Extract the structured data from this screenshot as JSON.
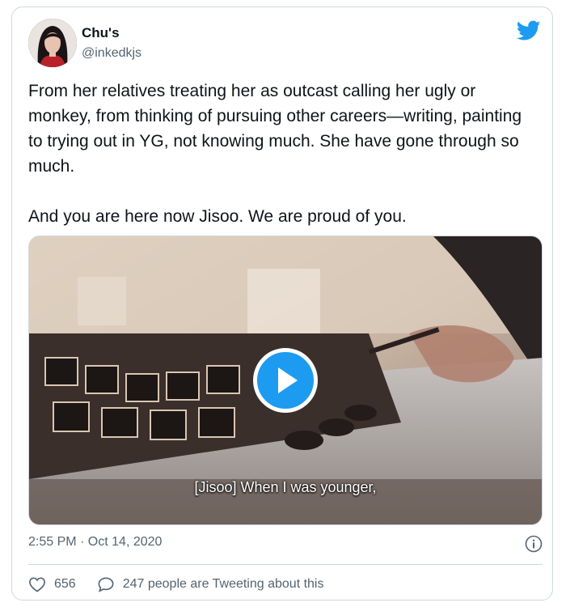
{
  "tweet": {
    "author": {
      "display_name": "Chu's",
      "handle": "@inkedkjs"
    },
    "paragraphs": [
      "From her relatives treating her as outcast calling her ugly or monkey, from thinking of pursuing other careers—writing, painting to trying out in YG, not knowing much. She have gone through so much.",
      "And you are here now Jisoo. We are proud of you."
    ],
    "media": {
      "subtitle": "[Jisoo] When I was younger,"
    },
    "timestamp": "2:55 PM · Oct 14, 2020",
    "likes": "656",
    "discussion": "247 people are Tweeting about this"
  },
  "icons": {
    "brand": "twitter-bird-icon",
    "play": "play-icon",
    "info": "info-icon",
    "like": "heart-icon",
    "reply": "speech-bubble-icon"
  },
  "colors": {
    "accent": "#1d9bf0",
    "secondary_text": "#536471",
    "border": "#cfd9de"
  }
}
